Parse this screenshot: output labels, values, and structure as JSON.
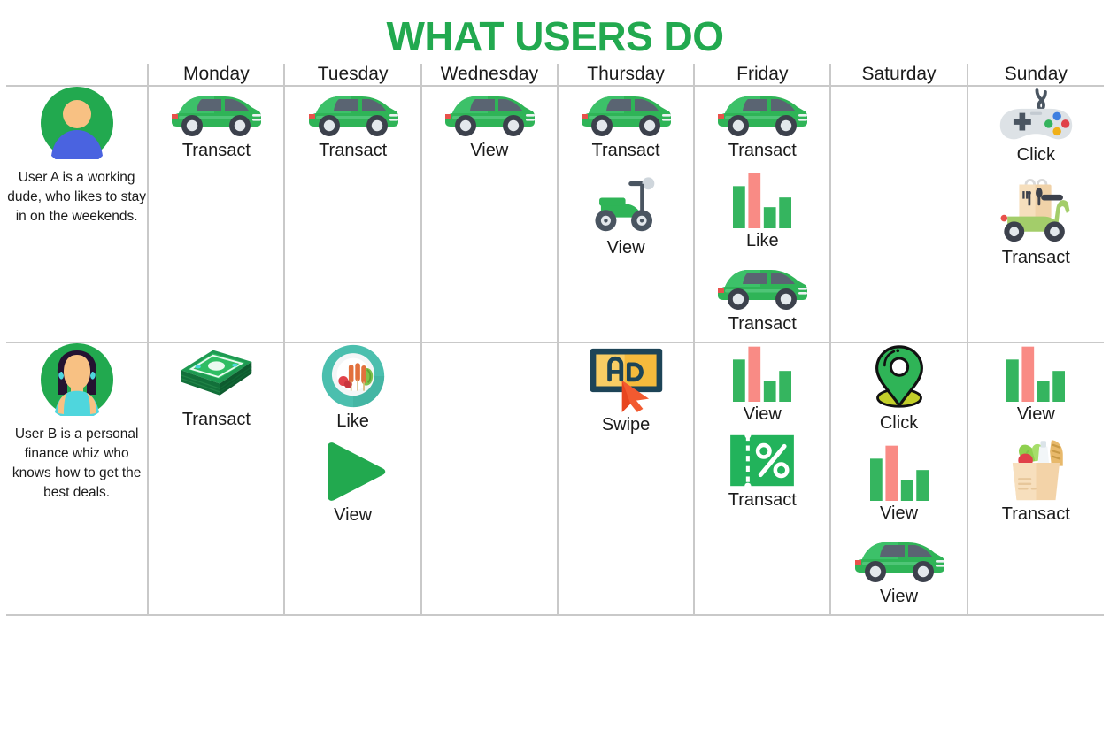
{
  "title": "WHAT USERS DO",
  "colors": {
    "title_green": "#22a94f",
    "grid_line": "#c9c9c9",
    "text": "#1b1b1b",
    "car_green": "#2fb457",
    "bar_green": "#35b55f",
    "bar_pink": "#f98b85",
    "avatar_circle_green": "#22a94f",
    "skin": "#f8c183",
    "userA_body_blue": "#4a63e0",
    "userB_hair": "#241331",
    "userB_top": "#4fd6dd",
    "ad_navy": "#1d4457",
    "ad_yellow": "#f5ba3c",
    "cursor_orange": "#f25a30",
    "pin_green": "#2fb457",
    "pin_base_olive": "#c3cf2a",
    "coupon_green": "#22b35b",
    "money_green": "#1e9a52",
    "bag_tan": "#f3d3a8",
    "delivery_scooter_green": "#a3cd6a",
    "play_green": "#22a94f",
    "plate_teal": "#4bbfae",
    "gamepad_gray": "#dde2e6"
  },
  "columns": {
    "user_header": "",
    "days": [
      "Monday",
      "Tuesday",
      "Wednesday",
      "Thursday",
      "Friday",
      "Saturday",
      "Sunday"
    ]
  },
  "rows": [
    {
      "user": {
        "name": "User A",
        "avatar": "avatar-user-a",
        "description": "User A is a working dude, who likes to stay in on the weekends."
      },
      "cells": [
        {
          "day": "Monday",
          "items": [
            {
              "icon": "car-icon",
              "label": "Transact"
            }
          ]
        },
        {
          "day": "Tuesday",
          "items": [
            {
              "icon": "car-icon",
              "label": "Transact"
            }
          ]
        },
        {
          "day": "Wednesday",
          "items": [
            {
              "icon": "car-icon",
              "label": "View"
            }
          ]
        },
        {
          "day": "Thursday",
          "items": [
            {
              "icon": "car-icon",
              "label": "Transact"
            },
            {
              "icon": "scooter-icon",
              "label": "View"
            }
          ]
        },
        {
          "day": "Friday",
          "items": [
            {
              "icon": "car-icon",
              "label": "Transact"
            },
            {
              "icon": "bar-chart-icon",
              "label": "Like"
            },
            {
              "icon": "car-icon",
              "label": "Transact"
            }
          ]
        },
        {
          "day": "Saturday",
          "items": []
        },
        {
          "day": "Sunday",
          "items": [
            {
              "icon": "gamepad-icon",
              "label": "Click"
            },
            {
              "icon": "delivery-scooter-icon",
              "label": "Transact"
            }
          ]
        }
      ]
    },
    {
      "user": {
        "name": "User B",
        "avatar": "avatar-user-b",
        "description": "User B is a personal finance whiz who knows how to get the best deals."
      },
      "cells": [
        {
          "day": "Monday",
          "items": [
            {
              "icon": "money-stack-icon",
              "label": "Transact"
            }
          ]
        },
        {
          "day": "Tuesday",
          "items": [
            {
              "icon": "food-plate-icon",
              "label": "Like"
            },
            {
              "icon": "play-icon",
              "label": "View"
            }
          ]
        },
        {
          "day": "Wednesday",
          "items": []
        },
        {
          "day": "Thursday",
          "items": [
            {
              "icon": "ad-cursor-icon",
              "label": "Swipe"
            }
          ]
        },
        {
          "day": "Friday",
          "items": [
            {
              "icon": "bar-chart-icon",
              "label": "View"
            },
            {
              "icon": "coupon-icon",
              "label": "Transact"
            }
          ]
        },
        {
          "day": "Saturday",
          "items": [
            {
              "icon": "map-pin-icon",
              "label": "Click"
            },
            {
              "icon": "bar-chart-icon",
              "label": "View"
            },
            {
              "icon": "car-icon",
              "label": "View"
            }
          ]
        },
        {
          "day": "Sunday",
          "items": [
            {
              "icon": "bar-chart-icon",
              "label": "View"
            },
            {
              "icon": "grocery-bag-icon",
              "label": "Transact"
            }
          ]
        }
      ]
    }
  ]
}
